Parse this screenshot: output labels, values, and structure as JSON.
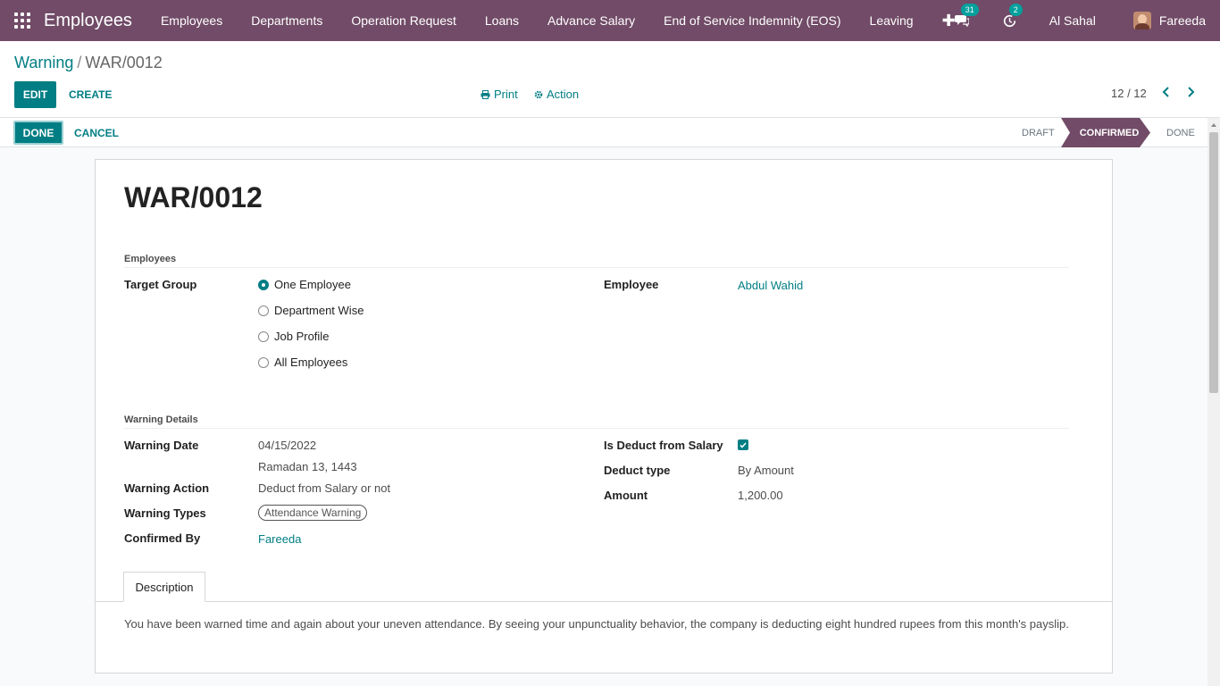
{
  "navbar": {
    "app_name": "Employees",
    "menu": [
      "Employees",
      "Departments",
      "Operation Request",
      "Loans",
      "Advance Salary",
      "End of Service Indemnity (EOS)",
      "Leaving"
    ],
    "messages_count": "31",
    "activities_count": "2",
    "company": "Al Sahal",
    "user": "Fareeda",
    "icons": [
      "apps-grid-icon",
      "plus-icon",
      "chat-icon",
      "clock-icon"
    ]
  },
  "breadcrumb": {
    "parent": "Warning",
    "separator": "/",
    "current": "WAR/0012"
  },
  "control": {
    "edit_label": "EDIT",
    "create_label": "CREATE",
    "print_label": "Print",
    "action_label": "Action",
    "pager": "12 / 12"
  },
  "statusbar": {
    "done_label": "DONE",
    "cancel_label": "CANCEL",
    "stages": [
      "DRAFT",
      "CONFIRMED",
      "DONE"
    ],
    "active_stage": "CONFIRMED"
  },
  "record": {
    "title": "WAR/0012",
    "employees_group": "Employees",
    "target_group_label": "Target Group",
    "target_options": [
      "One Employee",
      "Department Wise",
      "Job Profile",
      "All Employees"
    ],
    "target_selected": "One Employee",
    "employee_label": "Employee",
    "employee_value": "Abdul Wahid",
    "details_group": "Warning Details",
    "warning_date_label": "Warning Date",
    "warning_date_value": "04/15/2022",
    "warning_date_hijri": "Ramadan 13, 1443",
    "warning_action_label": "Warning Action",
    "warning_action_value": "Deduct from Salary or not",
    "warning_types_label": "Warning Types",
    "warning_types_value": "Attendance Warning",
    "confirmed_by_label": "Confirmed By",
    "confirmed_by_value": "Fareeda",
    "deduct_label": "Is Deduct from Salary",
    "deduct_checked": true,
    "deduct_type_label": "Deduct type",
    "deduct_type_value": "By Amount",
    "amount_label": "Amount",
    "amount_value": "1,200.00",
    "tab_label": "Description",
    "description": "You have been warned time and again about your uneven attendance. By seeing your unpunctuality behavior, the company is deducting eight hundred rupees from this month's payslip."
  },
  "colors": {
    "brand": "#714b67",
    "accent": "#017e84"
  }
}
